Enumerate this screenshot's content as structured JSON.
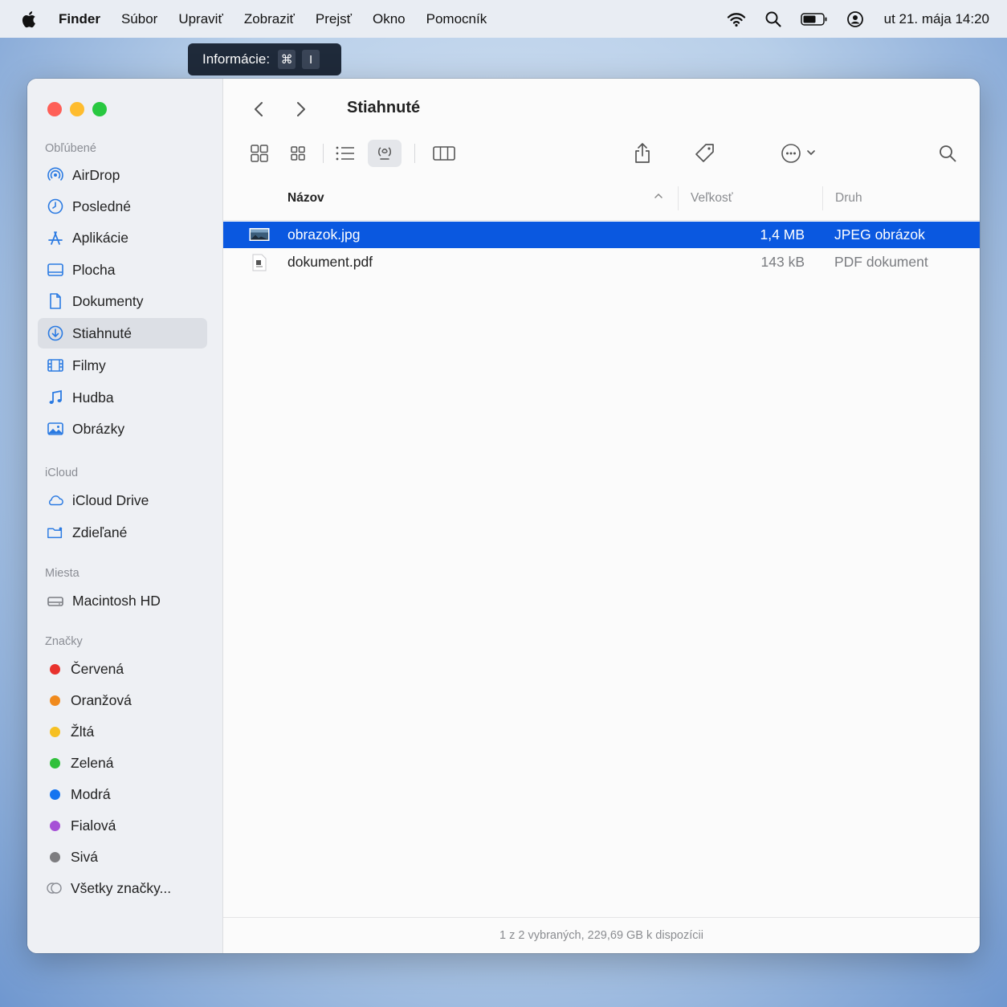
{
  "menubar": {
    "items": [
      {
        "label": "Finder"
      },
      {
        "label": "Súbor"
      },
      {
        "label": "Upraviť"
      },
      {
        "label": "Zobraziť"
      },
      {
        "label": "Prejsť"
      },
      {
        "label": "Okno"
      },
      {
        "label": "Pomocník"
      }
    ],
    "clock": "ut 21. mája  14:20",
    "status_icons": [
      "wifi-icon",
      "search-icon",
      "battery-icon",
      "user-icon"
    ]
  },
  "tooltip": {
    "label": "Informácie:",
    "key_cmd": "⌘",
    "key_letter": "I"
  },
  "window": {
    "title": "Stiahnuté",
    "traffic_colors": {
      "close": "#fe5f57",
      "minimize": "#febc2e",
      "zoom": "#28c840"
    }
  },
  "sidebar": {
    "favorites_title": "Obľúbené",
    "favorites": [
      {
        "label": "AirDrop",
        "icon": "airdrop-icon"
      },
      {
        "label": "Posledné",
        "icon": "clock-icon"
      },
      {
        "label": "Aplikácie",
        "icon": "apps-icon"
      },
      {
        "label": "Plocha",
        "icon": "desktop-icon"
      },
      {
        "label": "Dokumenty",
        "icon": "document-icon"
      },
      {
        "label": "Stiahnuté",
        "icon": "download-icon",
        "active": true
      },
      {
        "label": "Filmy",
        "icon": "film-icon"
      },
      {
        "label": "Hudba",
        "icon": "music-icon"
      },
      {
        "label": "Obrázky",
        "icon": "photo-icon"
      }
    ],
    "icloud_title": "iCloud",
    "icloud": [
      {
        "label": "iCloud Drive",
        "icon": "cloud-icon"
      },
      {
        "label": "Zdieľané",
        "icon": "shared-folder-icon"
      }
    ],
    "places_title": "Miesta",
    "places": [
      {
        "label": "Macintosh HD",
        "icon": "disk-icon"
      }
    ],
    "tags_title": "Značky",
    "tags": [
      {
        "label": "Červená",
        "color": "#e8322d"
      },
      {
        "label": "Oranžová",
        "color": "#f08a1d"
      },
      {
        "label": "Žltá",
        "color": "#f6c022"
      },
      {
        "label": "Zelená",
        "color": "#30c03b"
      },
      {
        "label": "Modrá",
        "color": "#1474f0"
      },
      {
        "label": "Fialová",
        "color": "#a650d6"
      },
      {
        "label": "Sivá",
        "color": "#7d7d80"
      }
    ],
    "all_tags": "Všetky značky..."
  },
  "list": {
    "col_name": "Názov",
    "col_size": "Veľkosť",
    "col_kind": "Druh",
    "rows": [
      {
        "name": "obrazok.jpg",
        "size": "1,4 MB",
        "kind": "JPEG obrázok",
        "selected": true
      },
      {
        "name": "dokument.pdf",
        "size": "143 kB",
        "kind": "PDF dokument",
        "selected": false
      }
    ]
  },
  "status": "1 z 2 vybraných, 229,69 GB k dispozícii",
  "accent_color": "#0a58e0"
}
